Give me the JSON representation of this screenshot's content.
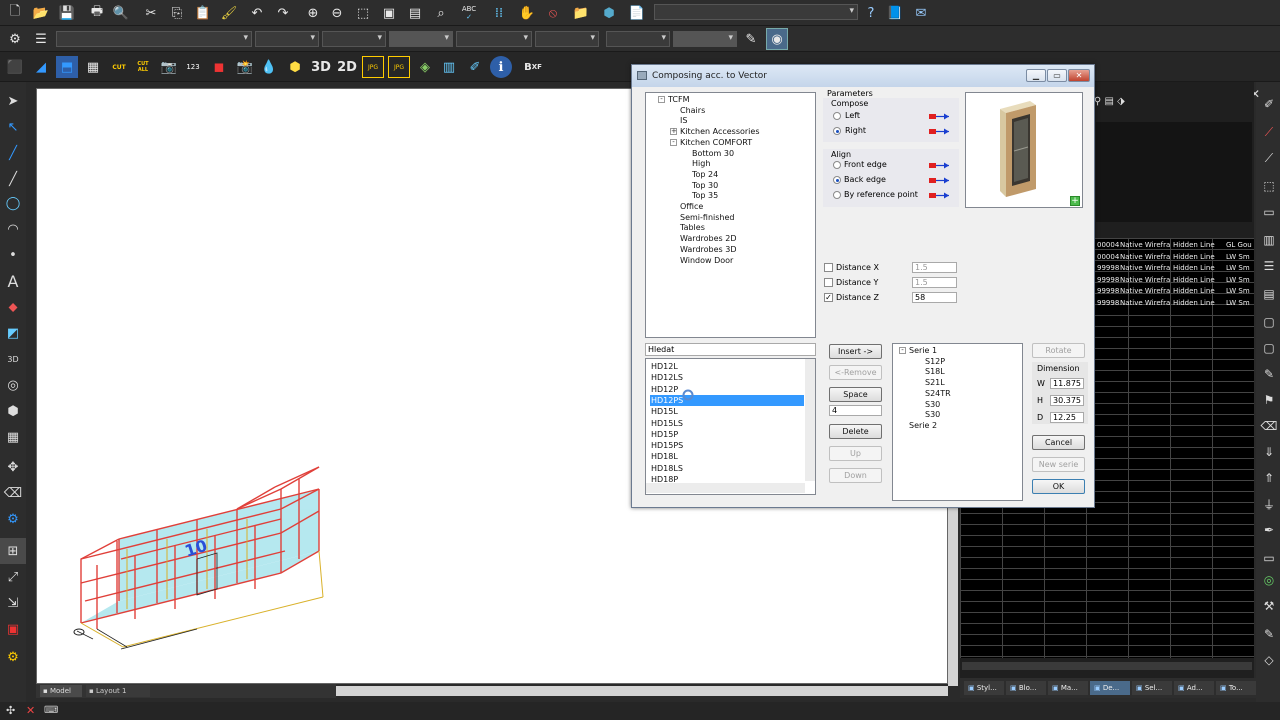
{
  "dialog": {
    "title": "Composing acc. to Vector",
    "tree": [
      {
        "label": "TCFM",
        "depth": 0,
        "exp": "-"
      },
      {
        "label": "Chairs",
        "depth": 1,
        "exp": ""
      },
      {
        "label": "IS",
        "depth": 1,
        "exp": ""
      },
      {
        "label": "Kitchen Accessories",
        "depth": 1,
        "exp": "+"
      },
      {
        "label": "Kitchen COMFORT",
        "depth": 1,
        "exp": "-"
      },
      {
        "label": "Bottom 30",
        "depth": 2,
        "exp": ""
      },
      {
        "label": "High",
        "depth": 2,
        "exp": ""
      },
      {
        "label": "Top 24",
        "depth": 2,
        "exp": ""
      },
      {
        "label": "Top 30",
        "depth": 2,
        "exp": ""
      },
      {
        "label": "Top 35",
        "depth": 2,
        "exp": ""
      },
      {
        "label": "Office",
        "depth": 1,
        "exp": ""
      },
      {
        "label": "Semi-finished",
        "depth": 1,
        "exp": ""
      },
      {
        "label": "Tables",
        "depth": 1,
        "exp": ""
      },
      {
        "label": "Wardrobes 2D",
        "depth": 1,
        "exp": ""
      },
      {
        "label": "Wardrobes 3D",
        "depth": 1,
        "exp": ""
      },
      {
        "label": "Window Door",
        "depth": 1,
        "exp": ""
      }
    ],
    "parameters_label": "Parameters",
    "compose_label": "Compose",
    "compose_left": "Left",
    "compose_right": "Right",
    "align_label": "Align",
    "align_front": "Front edge",
    "align_back": "Back edge",
    "align_ref": "By reference point",
    "dist_x_label": "Distance X",
    "dist_x_value": "1.5",
    "dist_y_label": "Distance Y",
    "dist_y_value": "1.5",
    "dist_z_label": "Distance Z",
    "dist_z_value": "58",
    "search_value": "Hledat",
    "list_items": [
      "HD12L",
      "HD12LS",
      "HD12P",
      "HD12PS",
      "HD15L",
      "HD15LS",
      "HD15P",
      "HD15PS",
      "HD18L",
      "HD18LS",
      "HD18P"
    ],
    "selected_item": "HD12PS",
    "btn_insert": "Insert ->",
    "btn_remove": "<-Remove",
    "btn_space": "Space",
    "space_value": "4",
    "btn_delete": "Delete",
    "btn_up": "Up",
    "btn_down": "Down",
    "series_tree": [
      {
        "label": "Serie  1",
        "depth": 0,
        "exp": "-"
      },
      {
        "label": "S12P",
        "depth": 1,
        "exp": ""
      },
      {
        "label": "S18L",
        "depth": 1,
        "exp": ""
      },
      {
        "label": "S21L",
        "depth": 1,
        "exp": ""
      },
      {
        "label": "S24TR",
        "depth": 1,
        "exp": ""
      },
      {
        "label": "S30",
        "depth": 1,
        "exp": ""
      },
      {
        "label": "S30",
        "depth": 1,
        "exp": ""
      },
      {
        "label": "Serie  2",
        "depth": 0,
        "exp": ""
      }
    ],
    "btn_rotate": "Rotate",
    "dimension_label": "Dimension",
    "dim_w_label": "W",
    "dim_w": "11.875",
    "dim_h_label": "H",
    "dim_h": "30.375",
    "dim_d_label": "D",
    "dim_d": "12.25",
    "btn_cancel": "Cancel",
    "btn_new_serie": "New serie",
    "btn_ok": "OK"
  },
  "toolbar": {
    "label_3d": "3D",
    "label_2d": "2D",
    "label_jpg1": "JPG",
    "label_jpg2": "JPG",
    "label_cut": "CUT",
    "label_cut_all": "CUT ALL",
    "label_123": "123",
    "label_abc": "ABC"
  },
  "layout_tabs": {
    "model": "Model",
    "layout1": "Layout 1"
  },
  "right_grid": {
    "rows": [
      [
        "00004",
        "Native Wirefra",
        "Hidden Line",
        "GL Gou"
      ],
      [
        "00004",
        "Native Wirefra",
        "Hidden Line",
        "LW Sm"
      ],
      [
        "99998",
        "Native Wirefra",
        "Hidden Line",
        "LW Sm"
      ],
      [
        "99998",
        "Native Wirefra",
        "Hidden Line",
        "LW Sm"
      ],
      [
        "99998",
        "Native Wirefra",
        "Hidden Line",
        "LW Sm"
      ],
      [
        "99998",
        "Native Wirefra",
        "Hidden Line",
        "LW Sm"
      ]
    ]
  },
  "bottom_tabs": [
    "Styl...",
    "Blo...",
    "Ma...",
    "De...",
    "Sel...",
    "Ad...",
    "To..."
  ],
  "cabinet_label": "10",
  "colors": {
    "accent": "#3399ff",
    "cabinet_frame": "#e0403a",
    "cabinet_glass": "#aee6ee"
  }
}
